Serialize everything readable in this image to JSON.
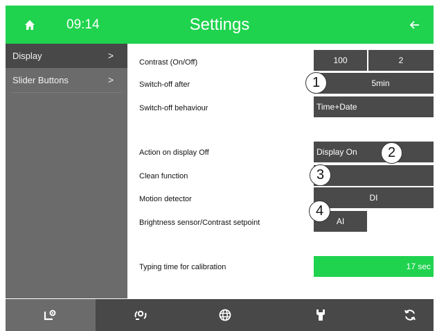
{
  "header": {
    "time": "09:14",
    "title": "Settings",
    "home_icon": "home-icon",
    "back_icon": "arrow-left-icon"
  },
  "sidebar": {
    "items": [
      {
        "label": "Display",
        "chevron": ">"
      },
      {
        "label": "Slider Buttons",
        "chevron": ">"
      }
    ]
  },
  "rows": {
    "contrast": {
      "label": "Contrast (On/Off)",
      "on": "100",
      "off": "2"
    },
    "switch_off_after": {
      "label": "Switch-off after",
      "value": "5min"
    },
    "switch_off_behaviour": {
      "label": "Switch-off behaviour",
      "value": "Time+Date"
    },
    "action_on_display_off": {
      "label": "Action on display Off",
      "value": "Display On"
    },
    "clean_function": {
      "label": "Clean function",
      "value": ""
    },
    "motion_detector": {
      "label": "Motion detector",
      "value": "DI"
    },
    "brightness_sensor": {
      "label": "Brightness sensor/Contrast setpoint",
      "value": "AI"
    },
    "typing_time": {
      "label": "Typing time for calibration",
      "value": "17 sec"
    }
  },
  "callouts": [
    "1",
    "2",
    "3",
    "4"
  ],
  "footer": {
    "icons": [
      "settings-screen-icon",
      "gear-sync-icon",
      "globe-icon",
      "wrench-icon",
      "refresh-icon"
    ]
  },
  "colors": {
    "accent": "#1fd34e",
    "sidebar": "#6b6b6b",
    "sidebar_active": "#484848",
    "control": "#4a4a4a",
    "footer": "#484848"
  }
}
